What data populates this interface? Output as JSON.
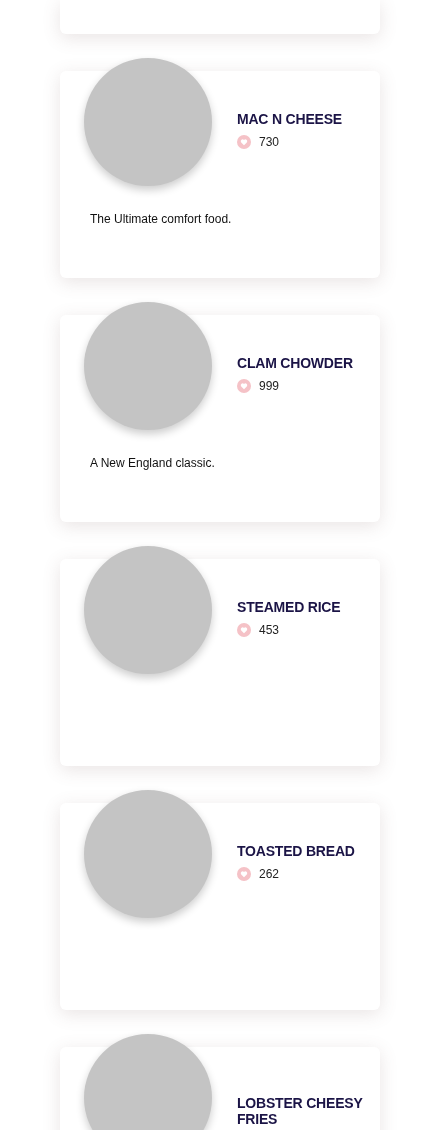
{
  "dishes": [
    {
      "name": "MAC N CHEESE",
      "likes": "730",
      "description": "The Ultimate comfort food."
    },
    {
      "name": "CLAM CHOWDER",
      "likes": "999",
      "description": "A New England classic."
    },
    {
      "name": "STEAMED RICE",
      "likes": "453"
    },
    {
      "name": "TOASTED BREAD",
      "likes": "262"
    },
    {
      "name": "LOBSTER CHEESY FRIES"
    }
  ]
}
